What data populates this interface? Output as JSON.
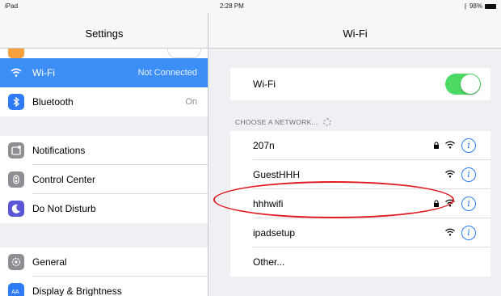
{
  "status_bar": {
    "device": "iPad",
    "time": "2:28 PM",
    "battery": "98%"
  },
  "left_pane": {
    "title": "Settings",
    "rows": [
      {
        "label": "Wi-Fi",
        "value": "Not Connected",
        "icon": "wifi-icon",
        "color": "#3d8ef7",
        "selected": true
      },
      {
        "label": "Bluetooth",
        "value": "On",
        "icon": "bluetooth-icon",
        "color": "#2f7bf5"
      },
      {
        "label": "Notifications",
        "value": "",
        "icon": "notifications-icon",
        "color": "#8e8e93"
      },
      {
        "label": "Control Center",
        "value": "",
        "icon": "control-center-icon",
        "color": "#8e8e93"
      },
      {
        "label": "Do Not Disturb",
        "value": "",
        "icon": "moon-icon",
        "color": "#5b56d6"
      },
      {
        "label": "General",
        "value": "",
        "icon": "gear-icon",
        "color": "#8e8e93"
      },
      {
        "label": "Display & Brightness",
        "value": "",
        "icon": "display-brightness-icon",
        "color": "#2f7bf5"
      }
    ]
  },
  "right_pane": {
    "title": "Wi-Fi",
    "wifi_toggle": {
      "label": "Wi-Fi",
      "on": true,
      "color": "#4cd964"
    },
    "section_label": "CHOOSE A NETWORK...",
    "networks": [
      {
        "name": "207n",
        "locked": true
      },
      {
        "name": "GuestHHH",
        "locked": false
      },
      {
        "name": "hhhwifi",
        "locked": true,
        "highlighted": true
      },
      {
        "name": "ipadsetup",
        "locked": false
      },
      {
        "name": "Other...",
        "other": true
      }
    ]
  },
  "colors": {
    "accent": "#2b7cf4",
    "annotation": "#e11b22"
  }
}
